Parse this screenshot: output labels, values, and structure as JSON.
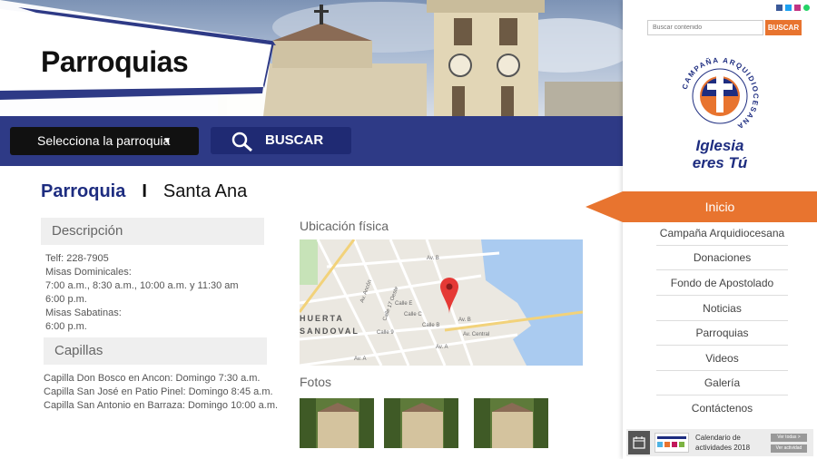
{
  "hero": {
    "title": "Parroquias"
  },
  "bar": {
    "select_label": "Selecciona la parroquia",
    "search_label": "BUSCAR"
  },
  "heading": {
    "prefix": "Parroquia",
    "separator": "I",
    "name": "Santa Ana"
  },
  "descripcion": {
    "label": "Descripción",
    "lines": [
      "Telf: 228-7905",
      "Misas Dominicales:",
      "7:00 a.m., 8:30 a.m., 10:00 a.m. y 11:30 am",
      "6:00 p.m.",
      "Misas Sabatinas:",
      "6:00 p.m."
    ]
  },
  "capillas": {
    "label": "Capillas",
    "lines": [
      "Capilla Don Bosco en Ancon:  Domingo 7:30 a.m.",
      "Capilla San José en Patio Pinel:  Domingo 8:45 a.m.",
      "Capilla San Antonio en Barraza:  Domingo 10:00 a.m."
    ]
  },
  "map": {
    "label": "Ubicación física",
    "streets": [
      "Av. B",
      "Av. Ancón",
      "Calle 17 Oeste",
      "Calle E",
      "Calle C",
      "Calle B",
      "Av. B",
      "Av. Central",
      "Av. A",
      "Calle 9",
      "Av. A"
    ],
    "district": [
      "HUERTA",
      "SANDOVAL"
    ]
  },
  "fotos": {
    "label": "Fotos"
  },
  "sidebar": {
    "search_placeholder": "Buscar contenido",
    "search_button": "BUSCAR",
    "logo": {
      "arc_text": "CAMPAÑA ARQUIDIOCESANA",
      "line1": "Iglesia",
      "line2": "eres Tú"
    },
    "menu": [
      "Inicio",
      "Campaña Arquidiocesana",
      "Donaciones",
      "Fondo de Apostolado",
      "Noticias",
      "Parroquias",
      "Videos",
      "Galería",
      "Contáctenos"
    ],
    "calendar": {
      "title": "Calendario de actividades 2018",
      "btn1": "Ver todas >",
      "btn2": "Ver actividad"
    }
  },
  "colors": {
    "navy": "#2e3a86",
    "orange": "#e8742f"
  }
}
